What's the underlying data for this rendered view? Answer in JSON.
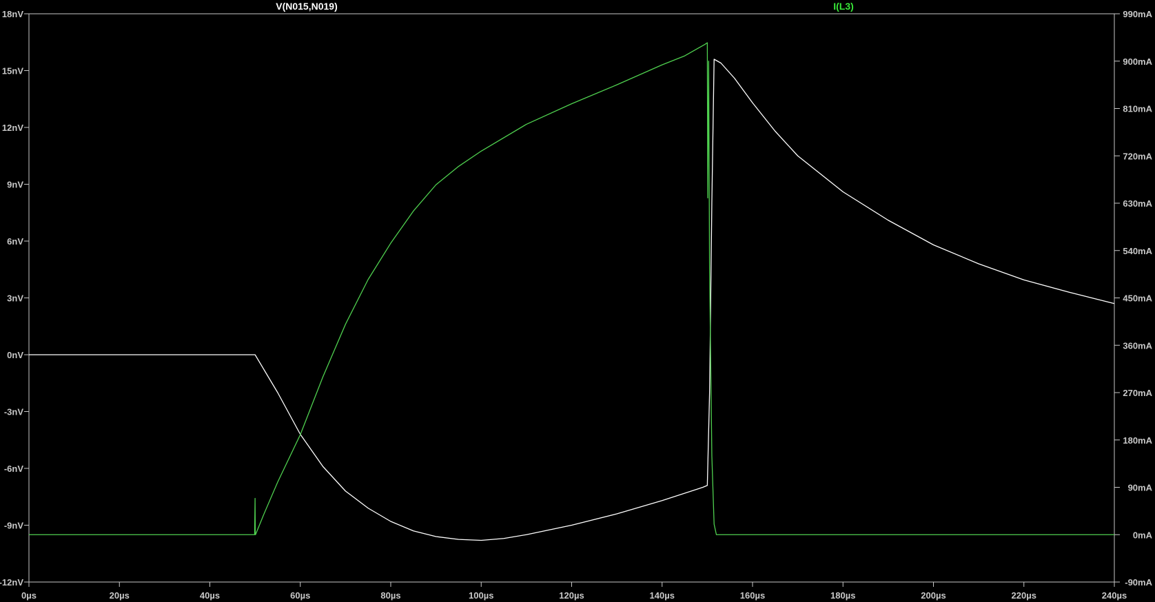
{
  "chart_data": {
    "type": "line",
    "title_left": "V(N015,N019)",
    "title_right": "I(L3)",
    "xlabel": "",
    "x_ticks": [
      "0µs",
      "20µs",
      "40µs",
      "60µs",
      "80µs",
      "100µs",
      "120µs",
      "140µs",
      "160µs",
      "180µs",
      "200µs",
      "220µs",
      "240µs"
    ],
    "xlim": [
      0,
      240
    ],
    "y_left_ticks": [
      "18nV",
      "15nV",
      "12nV",
      "9nV",
      "6nV",
      "3nV",
      "0nV",
      "-3nV",
      "-6nV",
      "-9nV",
      "-12nV"
    ],
    "ylim_left": [
      -12,
      18
    ],
    "y_right_ticks": [
      "990mA",
      "900mA",
      "810mA",
      "720mA",
      "630mA",
      "540mA",
      "450mA",
      "360mA",
      "270mA",
      "180mA",
      "90mA",
      "0mA",
      "-90mA"
    ],
    "ylim_right": [
      -90,
      990
    ],
    "grid": false,
    "colors": {
      "background": "#000000",
      "axis": "#c8c8c8",
      "voltage": "#ffffff",
      "current": "#4fd04f",
      "current_title": "#38e838"
    },
    "series": [
      {
        "name": "V(N015,N019)",
        "axis": "left",
        "unit": "nV",
        "x": [
          0,
          50,
          52,
          55,
          60,
          65,
          70,
          75,
          80,
          85,
          90,
          95,
          100,
          105,
          110,
          120,
          130,
          140,
          149,
          150,
          150.5,
          151,
          151.5,
          153,
          156,
          160,
          165,
          170,
          180,
          190,
          200,
          210,
          220,
          230,
          240
        ],
        "y": [
          0,
          0,
          -0.8,
          -2.0,
          -4.2,
          -5.9,
          -7.2,
          -8.1,
          -8.8,
          -9.3,
          -9.6,
          -9.75,
          -9.8,
          -9.7,
          -9.5,
          -9.0,
          -8.4,
          -7.7,
          -7.0,
          -6.9,
          -2.0,
          8.0,
          15.6,
          15.4,
          14.6,
          13.3,
          11.8,
          10.5,
          8.6,
          7.1,
          5.8,
          4.8,
          3.95,
          3.3,
          2.7
        ]
      },
      {
        "name": "I(L3)",
        "axis": "right",
        "unit": "mA",
        "x": [
          0,
          49.9,
          50,
          50.05,
          50.1,
          52,
          55,
          60,
          65,
          70,
          75,
          80,
          85,
          90,
          95,
          100,
          110,
          120,
          130,
          140,
          145,
          149.5,
          150,
          150.1,
          150.3,
          150.5,
          151,
          151.5,
          152,
          155,
          240
        ],
        "y": [
          0,
          0,
          69,
          0,
          0,
          40,
          100,
          190,
          300,
          400,
          485,
          554,
          615,
          665,
          700,
          729,
          780,
          819,
          855,
          893,
          910,
          932,
          935,
          640,
          900,
          500,
          150,
          20,
          0,
          0,
          0
        ]
      }
    ]
  }
}
